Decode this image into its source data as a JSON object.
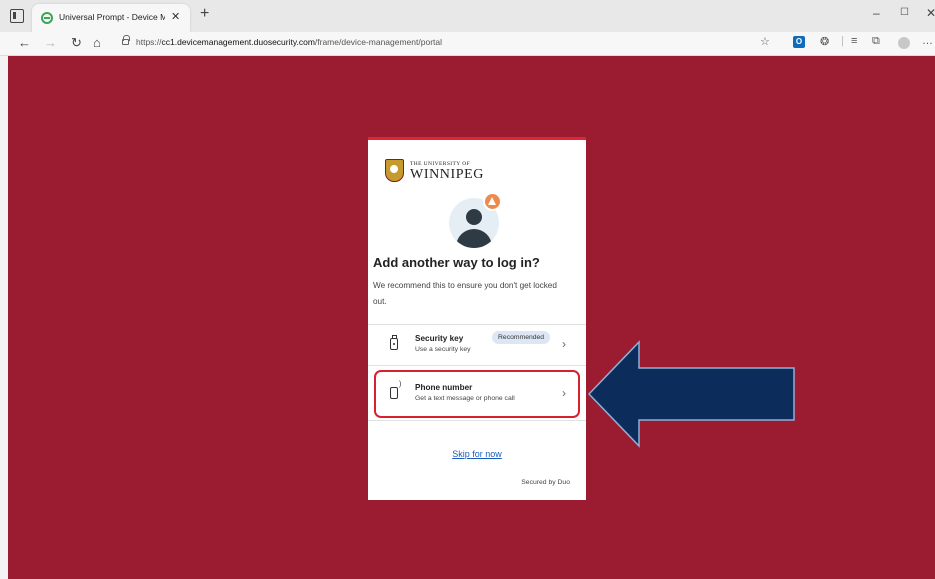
{
  "browser": {
    "tab_title": "Universal Prompt - Device Mana",
    "tab_close": "✕",
    "new_tab": "+",
    "url_prefix": "https://",
    "url_host": "cc1.devicemanagement.duosecurity.com",
    "url_path": "/frame/device-management/portal",
    "window_controls": [
      "–",
      "☐",
      "✕"
    ],
    "outlook_letter": "O"
  },
  "colors": {
    "page_background": "#9b1b30",
    "card_accent": "#e02434",
    "arrow_fill": "#0c2d5c",
    "link": "#1a5dbd"
  },
  "logo": {
    "small_text": "THE UNIVERSITY OF",
    "big_text": "WINNIPEG"
  },
  "prompt": {
    "title": "Add another way to log in?",
    "description": "We recommend this to ensure you don't get locked out."
  },
  "options": [
    {
      "label": "Security key",
      "badge": "Recommended",
      "subtitle": "Use a security key",
      "icon": "security-key-icon"
    },
    {
      "label": "Phone number",
      "subtitle": "Get a text message or phone call",
      "icon": "phone-icon"
    }
  ],
  "chevron": "›",
  "skip_label": "Skip for now",
  "footer": "Secured by Duo"
}
